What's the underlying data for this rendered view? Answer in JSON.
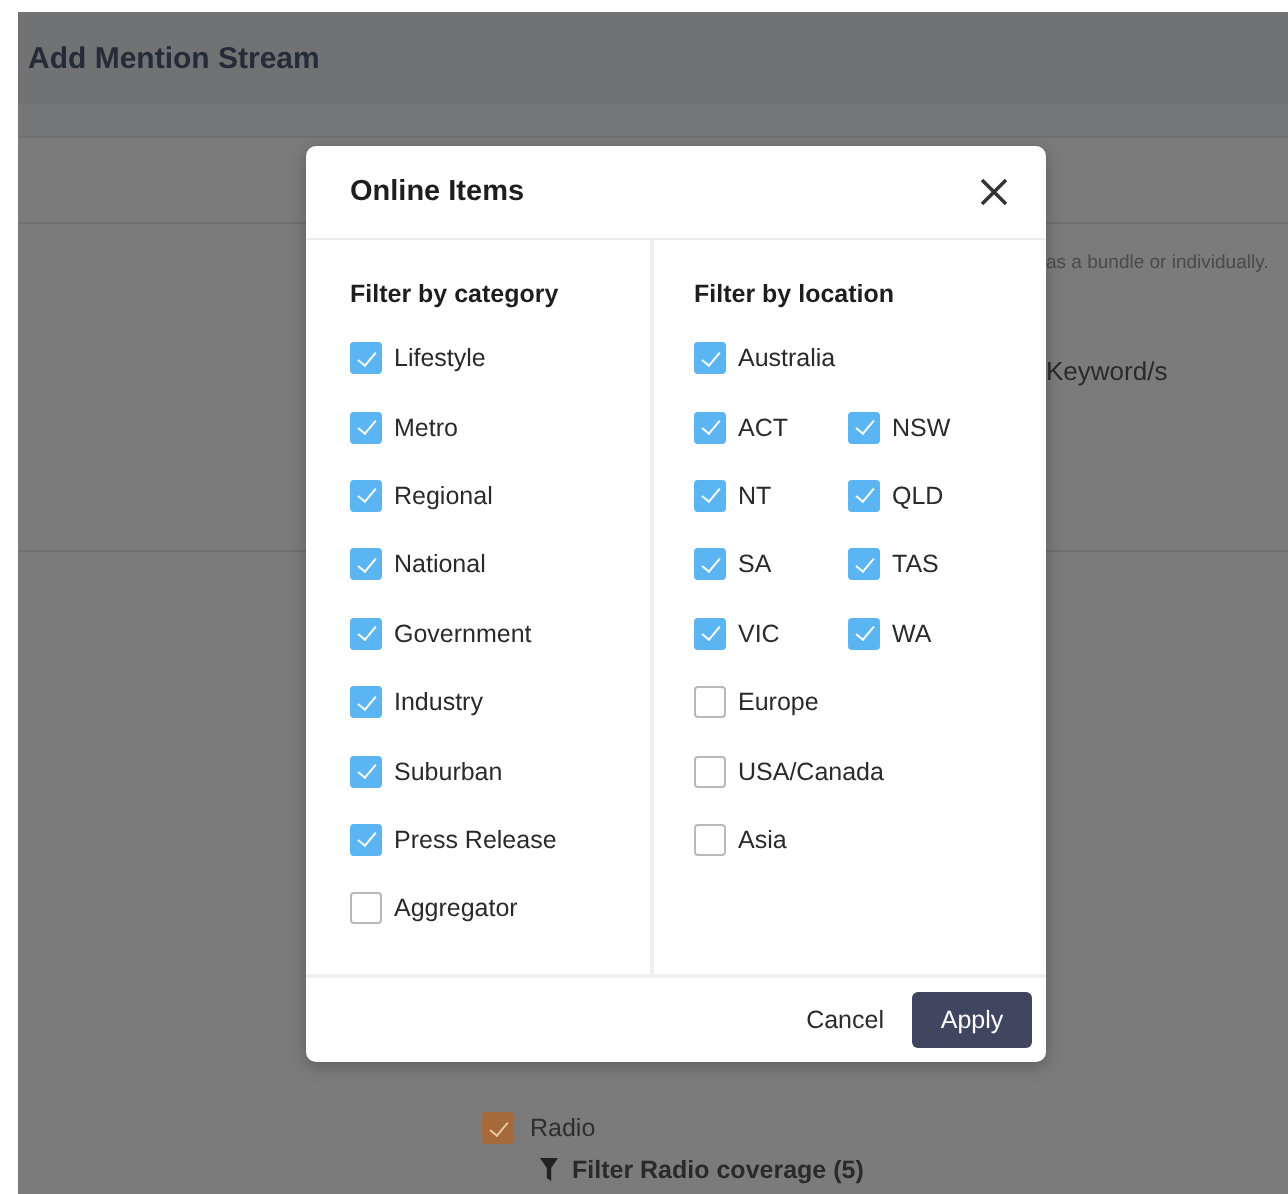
{
  "page": {
    "title": "Add Mention Stream",
    "hint": "as a bundle or individually.",
    "keyword_label": "Keyword/s",
    "radio": {
      "label": "Radio",
      "checked": true
    },
    "radio_filter": "Filter Radio coverage (5)"
  },
  "dialog": {
    "title": "Online Items",
    "category": {
      "heading": "Filter by category",
      "items": [
        {
          "label": "Lifestyle",
          "checked": true
        },
        {
          "label": "Metro",
          "checked": true
        },
        {
          "label": "Regional",
          "checked": true
        },
        {
          "label": "National",
          "checked": true
        },
        {
          "label": "Government",
          "checked": true
        },
        {
          "label": "Industry",
          "checked": true
        },
        {
          "label": "Suburban",
          "checked": true
        },
        {
          "label": "Press Release",
          "checked": true
        },
        {
          "label": "Aggregator",
          "checked": false
        }
      ]
    },
    "location": {
      "heading": "Filter by location",
      "items": [
        {
          "label": "Australia",
          "checked": true,
          "children": [
            {
              "label": "ACT",
              "checked": true
            },
            {
              "label": "NSW",
              "checked": true
            },
            {
              "label": "NT",
              "checked": true
            },
            {
              "label": "QLD",
              "checked": true
            },
            {
              "label": "SA",
              "checked": true
            },
            {
              "label": "TAS",
              "checked": true
            },
            {
              "label": "VIC",
              "checked": true
            },
            {
              "label": "WA",
              "checked": true
            }
          ]
        },
        {
          "label": "Europe",
          "checked": false
        },
        {
          "label": "USA/Canada",
          "checked": false
        },
        {
          "label": "Asia",
          "checked": false
        }
      ]
    },
    "buttons": {
      "cancel": "Cancel",
      "apply": "Apply"
    }
  }
}
